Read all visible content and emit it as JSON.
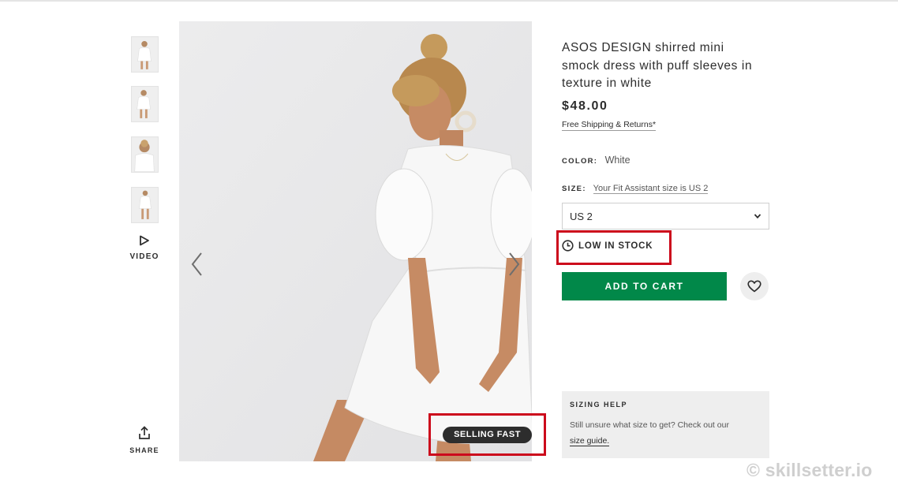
{
  "gallery": {
    "video_label": "VIDEO",
    "share_label": "SHARE",
    "badge": "SELLING FAST"
  },
  "product": {
    "title": "ASOS DESIGN shirred mini smock dress with puff sleeves in texture in white",
    "price": "$48.00",
    "shipping": "Free Shipping & Returns*",
    "color_label": "COLOR:",
    "color_value": "White",
    "size_label": "SIZE:",
    "fit_assistant": "Your Fit Assistant size is US 2",
    "selected_size": "US 2",
    "stock_status": "LOW IN STOCK",
    "add_to_cart": "ADD TO CART"
  },
  "sizing_help": {
    "heading": "SIZING HELP",
    "body": "Still unsure what size to get? Check out our",
    "link": "size guide."
  },
  "watermark": "© skillsetter.io",
  "colors": {
    "accent_green": "#018849",
    "highlight_red": "#cc0a1c",
    "text_dark": "#2d2d2d"
  }
}
